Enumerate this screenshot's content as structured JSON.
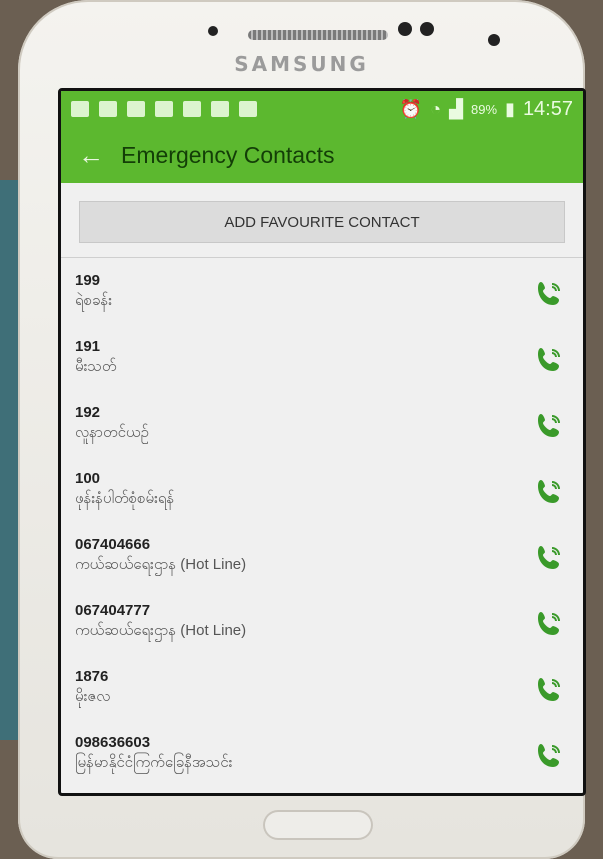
{
  "device": {
    "brand": "SAMSUNG"
  },
  "status_bar": {
    "battery": "89%",
    "time": "14:57"
  },
  "app_bar": {
    "title": "Emergency Contacts"
  },
  "add_button": {
    "label": "ADD FAVOURITE CONTACT"
  },
  "colors": {
    "accent": "#5cb82f",
    "call_icon": "#3a9a2a"
  },
  "contacts": [
    {
      "number": "199",
      "name": "ရဲစခန်း"
    },
    {
      "number": "191",
      "name": "မီးသတ်"
    },
    {
      "number": "192",
      "name": "လူနာတင်ယဉ်"
    },
    {
      "number": "100",
      "name": "ဖုန်းနံပါတ်စုံစမ်းရန်"
    },
    {
      "number": "067404666",
      "name": "ကယ်ဆယ်ရေးဌာန (Hot Line)"
    },
    {
      "number": "067404777",
      "name": "ကယ်ဆယ်ရေးဌာန (Hot Line)"
    },
    {
      "number": "1876",
      "name": "မိုးဇလ"
    },
    {
      "number": "098636603",
      "name": "မြန်မာနိုင်ငံကြက်ခြေနီအသင်း"
    }
  ]
}
